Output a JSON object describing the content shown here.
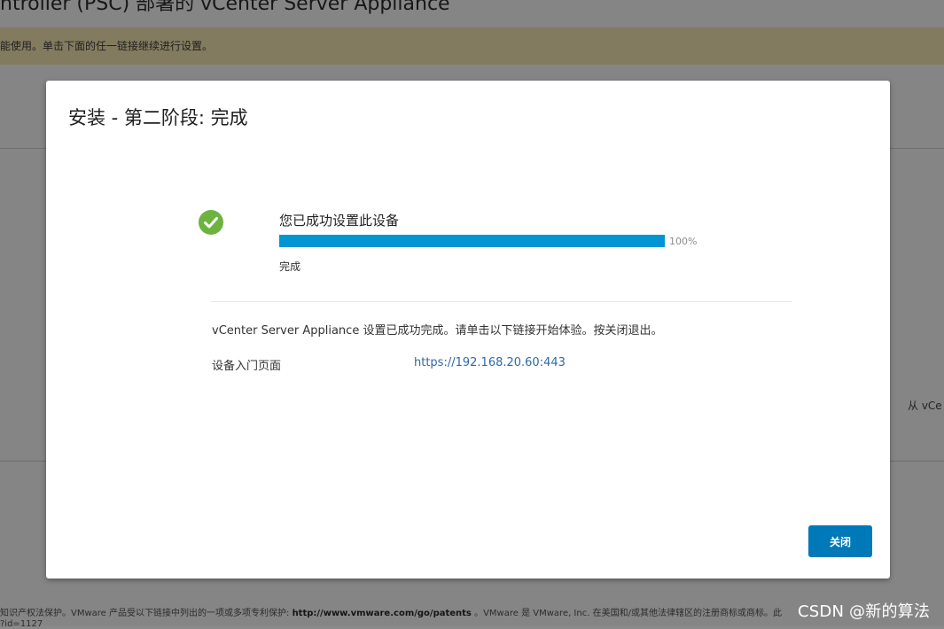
{
  "background": {
    "title": "ntroller (PSC) 部署的 vCenter Server Appliance",
    "warning": "能使用。单击下面的任一链接继续进行设置。",
    "right_text": "从 vCe",
    "footer": {
      "prefix": "知识产权法保护。VMware 产品受以下链接中列出的一项或多项专利保护:",
      "link": "http://www.vmware.com/go/patents",
      "suffix": "。VMware 是 VMware, Inc. 在美国和/或其他法律辖区的注册商标或商标。此",
      "line2": "?id=1127"
    }
  },
  "modal": {
    "title": "安装 - 第二阶段: 完成",
    "status_title": "您已成功设置此设备",
    "progress_percent": 100,
    "progress_label": "100%",
    "status_text": "完成",
    "complete_message": "vCenter Server Appliance 设置已成功完成。请单击以下链接开始体验。按关闭退出。",
    "link_label": "设备入门页面",
    "link_url": "https://192.168.20.60:443",
    "close_button": "关闭"
  },
  "icons": {
    "success": "check-circle-icon"
  },
  "colors": {
    "success": "#6db33f",
    "progress": "#0095d3",
    "primary": "#0079b8",
    "link": "#2d6aa6",
    "warning_bg": "#fcebb6"
  },
  "watermark": "CSDN @新的算法"
}
